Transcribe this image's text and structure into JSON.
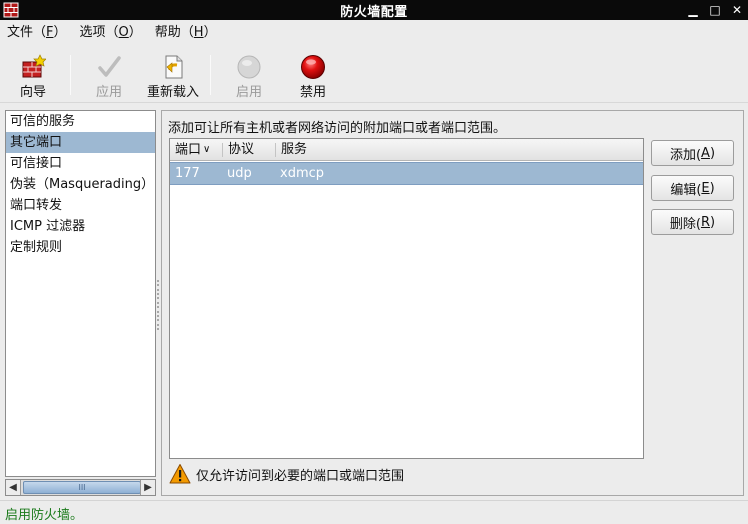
{
  "window": {
    "title": "防火墙配置",
    "controls": {
      "minimize": "▁",
      "maximize": "□",
      "close": "✕"
    }
  },
  "menubar": {
    "items": [
      {
        "label": "文件（",
        "mnemonic": "F",
        "suffix": "）"
      },
      {
        "label": "选项（",
        "mnemonic": "O",
        "suffix": "）"
      },
      {
        "label": "帮助（",
        "mnemonic": "H",
        "suffix": "）"
      }
    ]
  },
  "toolbar": {
    "wizard_label": "向导",
    "apply_label": "应用",
    "reload_label": "重新载入",
    "enable_label": "启用",
    "disable_label": "禁用"
  },
  "sidebar": {
    "items": [
      {
        "label": "可信的服务"
      },
      {
        "label": "其它端口"
      },
      {
        "label": "可信接口"
      },
      {
        "label": "伪装（Masquerading）"
      },
      {
        "label": "端口转发"
      },
      {
        "label": "ICMP 过滤器"
      },
      {
        "label": "定制规则"
      }
    ],
    "selected_index": 1,
    "scroll_grip": "III"
  },
  "main": {
    "description": "添加可让所有主机或者网络访问的附加端口或者端口范围。",
    "table": {
      "columns": [
        "端口",
        "协议",
        "服务"
      ],
      "sort_indicator": "∨",
      "rows": [
        {
          "port": "177",
          "protocol": "udp",
          "service": "xdmcp"
        }
      ]
    },
    "buttons": {
      "add": {
        "label": "添加(",
        "mnemonic": "A",
        "suffix": ")"
      },
      "edit": {
        "label": "编辑(",
        "mnemonic": "E",
        "suffix": ")"
      },
      "remove": {
        "label": "删除(",
        "mnemonic": "R",
        "suffix": ")"
      }
    },
    "warning": "仅允许访问到必要的端口或端口范围"
  },
  "status": {
    "text": "启用防火墙。"
  },
  "colors": {
    "selection": "#9db8d2",
    "status_text": "#1a7a1a",
    "disable_red": "#e01010",
    "warning_orange": "#f08a00"
  }
}
